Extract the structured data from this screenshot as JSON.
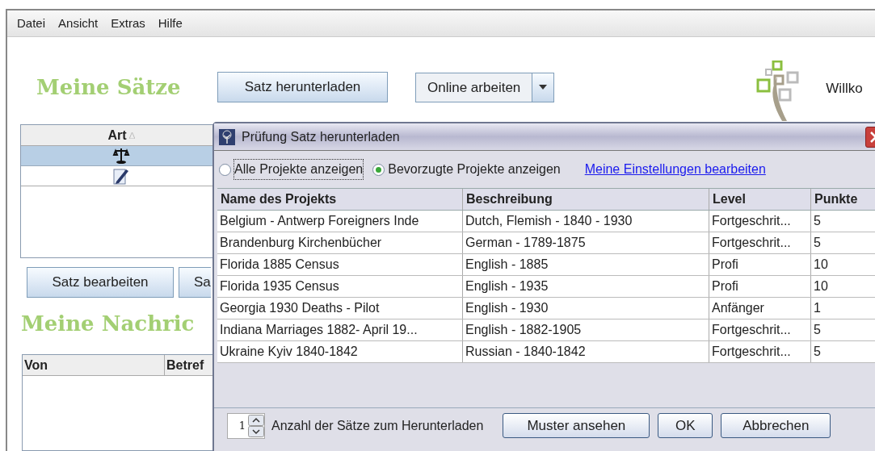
{
  "menu": [
    {
      "label": "Datei"
    },
    {
      "label": "Ansicht"
    },
    {
      "label": "Extras"
    },
    {
      "label": "Hilfe"
    }
  ],
  "main": {
    "heading": "Meine Sätze",
    "download_button": "Satz herunterladen",
    "mode_button": "Online arbeiten",
    "welcome": "Willko",
    "sets_table": {
      "column": "Art",
      "rows": [
        {
          "kind": "review",
          "selected": true
        },
        {
          "kind": "edit",
          "selected": false
        }
      ]
    },
    "buttons": [
      "Satz bearbeiten",
      "Sa"
    ],
    "messages_heading": "Meine Nachric",
    "messages_columns": [
      "Von",
      "Betref"
    ]
  },
  "dialog": {
    "title": "Prüfung Satz herunterladen",
    "filters": [
      {
        "label": "Alle Projekte anzeigen",
        "selected": false
      },
      {
        "label": "Bevorzugte Projekte anzeigen",
        "selected": true
      }
    ],
    "settings_link": "Meine Einstellungen bearbeiten",
    "columns": [
      "Name des Projekts",
      "Beschreibung",
      "Level",
      "Punkte"
    ],
    "rows": [
      [
        "Belgium - Antwerp Foreigners Inde",
        "Dutch, Flemish - 1840 - 1930",
        "Fortgeschrit...",
        "5"
      ],
      [
        "Brandenburg Kirchenbücher",
        "German - 1789-1875",
        "Fortgeschrit...",
        "5"
      ],
      [
        "Florida 1885 Census",
        "English - 1885",
        "Profi",
        "10"
      ],
      [
        "Florida 1935 Census",
        "English - 1935",
        "Profi",
        "10"
      ],
      [
        "Georgia 1930 Deaths - Pilot",
        "English - 1930",
        "Anfänger",
        "1"
      ],
      [
        "Indiana Marriages 1882- April 19...",
        "English - 1882-1905",
        "Fortgeschrit...",
        "5"
      ],
      [
        "Ukraine Kyiv 1840-1842",
        "Russian - 1840-1842",
        "Fortgeschrit...",
        "5"
      ]
    ],
    "count": "1",
    "count_label": "Anzahl der Sätze zum Herunterladen",
    "buttons": [
      "Muster ansehen",
      "OK",
      "Abbrechen"
    ]
  }
}
